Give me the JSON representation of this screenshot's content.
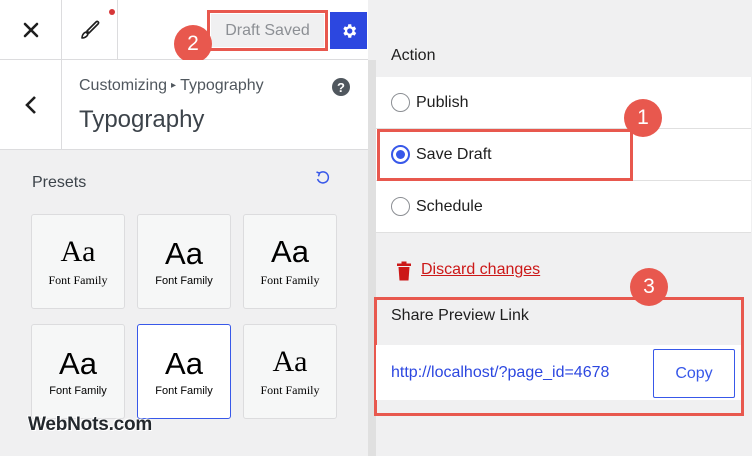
{
  "toolbar": {
    "close_icon": "close-icon",
    "brush_icon": "paintbrush-icon",
    "draft_saved_label": "Draft Saved",
    "settings_icon": "gear-icon"
  },
  "header": {
    "breadcrumb_prefix": "Customizing",
    "breadcrumb_section": "Typography",
    "title": "Typography"
  },
  "presets": {
    "label": "Presets",
    "items": [
      {
        "sample": "Aa",
        "label": "Font Family",
        "style": "serif"
      },
      {
        "sample": "Aa",
        "label": "Font Family",
        "style": "sans"
      },
      {
        "sample": "Aa",
        "label": "Font Family",
        "style": "sans-serif-mix"
      },
      {
        "sample": "Aa",
        "label": "Font Family",
        "style": "sans"
      },
      {
        "sample": "Aa",
        "label": "Font Family",
        "style": "sans",
        "selected": true
      },
      {
        "sample": "Aa",
        "label": "Font Family",
        "style": "serif"
      }
    ]
  },
  "publish_panel": {
    "action_label": "Action",
    "options": [
      {
        "label": "Publish",
        "checked": false
      },
      {
        "label": "Save Draft",
        "checked": true
      },
      {
        "label": "Schedule",
        "checked": false
      }
    ],
    "discard_label": "Discard changes",
    "share_label": "Share Preview Link",
    "share_url": "http://localhost/?page_id=4678",
    "copy_label": "Copy"
  },
  "annotations": {
    "badge_1": "1",
    "badge_2": "2",
    "badge_3": "3"
  },
  "watermark": "WebNots.com",
  "colors": {
    "accent": "#3858e9",
    "annotation": "#e8584e",
    "danger": "#cc1818"
  }
}
